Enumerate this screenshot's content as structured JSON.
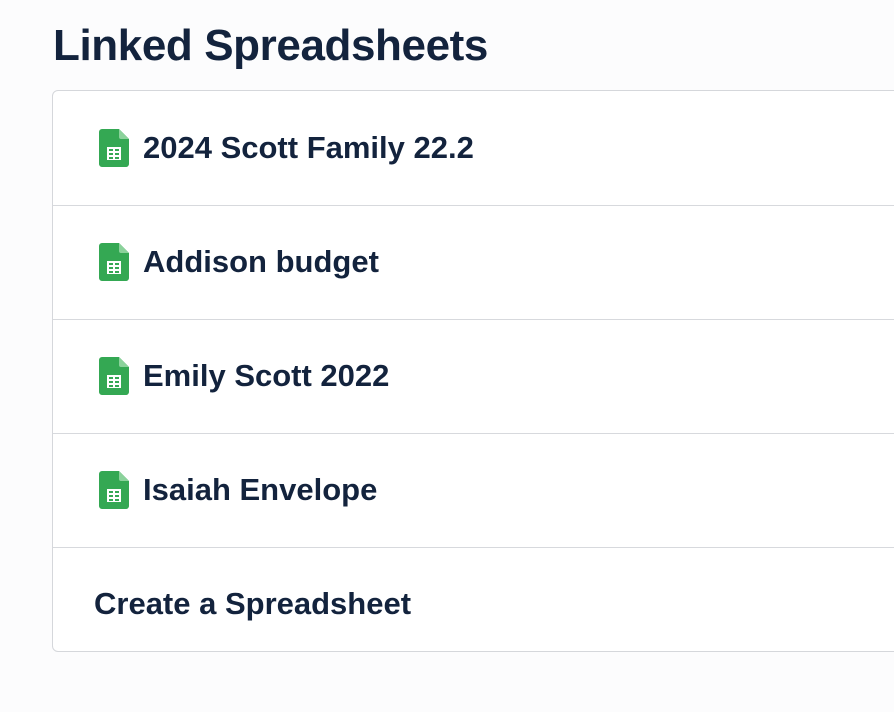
{
  "title": "Linked Spreadsheets",
  "spreadsheets": [
    {
      "name": "2024 Scott Family 22.2",
      "icon": "spreadsheet-icon"
    },
    {
      "name": "Addison budget",
      "icon": "spreadsheet-icon"
    },
    {
      "name": "Emily Scott 2022",
      "icon": "spreadsheet-icon"
    },
    {
      "name": "Isaiah Envelope",
      "icon": "spreadsheet-icon"
    }
  ],
  "create_label": "Create a Spreadsheet",
  "colors": {
    "text": "#13233d",
    "sheet_green": "#34a853",
    "sheet_green_fold": "#8bd29b",
    "border": "#d5d7db",
    "background": "#fcfcfd"
  }
}
